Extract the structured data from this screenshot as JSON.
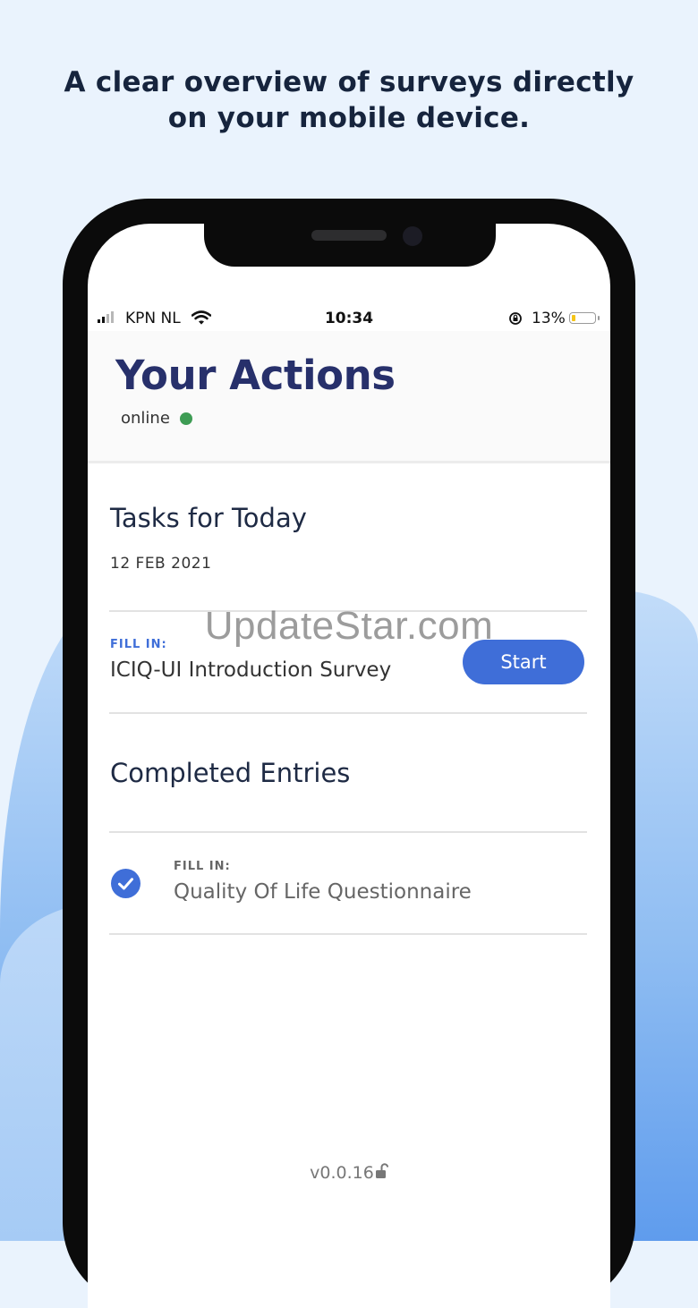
{
  "promo": {
    "headline_line1": "A clear overview of surveys directly",
    "headline_line2": "on your mobile device."
  },
  "status_bar": {
    "carrier": "KPN NL",
    "time": "10:34",
    "battery_percent_label": "13%",
    "battery_level": 0.13,
    "icons": [
      "signal-icon",
      "wifi-icon",
      "orientation-lock-icon",
      "battery-icon"
    ]
  },
  "header": {
    "title": "Your Actions",
    "connection_status": "online",
    "connection_color": "#3e9c54"
  },
  "tasks": {
    "section_title": "Tasks for Today",
    "date": "12 FEB 2021",
    "items": [
      {
        "label": "FILL IN:",
        "title": "ICIQ-UI Introduction Survey",
        "action": "Start"
      }
    ]
  },
  "completed": {
    "section_title": "Completed Entries",
    "items": [
      {
        "label": "FILL IN:",
        "title": "Quality Of Life Questionnaire",
        "icon": "check-circle-icon"
      }
    ]
  },
  "footer": {
    "version": "v0.0.16",
    "icon": "unlocked-icon"
  },
  "watermark": "UpdateStar.com",
  "colors": {
    "accent": "#3f6ed8",
    "title": "#27306b",
    "fill_label_active": "#3f6ed8",
    "fill_label_done": "#666666"
  }
}
